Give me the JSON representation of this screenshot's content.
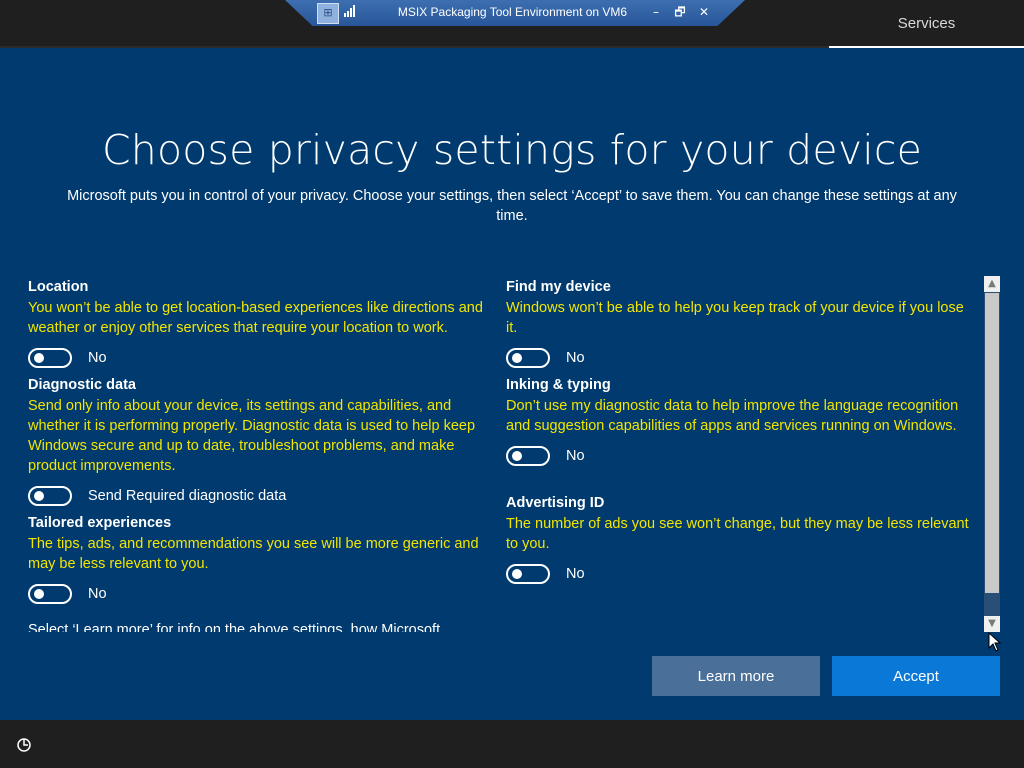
{
  "window": {
    "vm_title": "MSIX Packaging Tool Environment on VM6",
    "pin_icon": "pin-icon",
    "signal_icon": "signal-bars-icon",
    "controls": {
      "minimize": "–",
      "restore": "🗗",
      "close": "✕"
    }
  },
  "topbar": {
    "services_tab": "Services"
  },
  "page": {
    "title": "Choose privacy settings for your device",
    "subtitle": "Microsoft puts you in control of your privacy. Choose your settings, then select ‘Accept’ to save them. You can change these settings at any time."
  },
  "settings": {
    "left": [
      {
        "title": "Location",
        "description": "You won’t be able to get location-based experiences like directions and weather or enjoy other services that require your location to work.",
        "toggle": "No"
      },
      {
        "title": "Diagnostic data",
        "description": "Send only info about your device, its settings and capabilities, and whether it is performing properly. Diagnostic data is used to help keep Windows secure and up to date, troubleshoot problems, and make product improvements.",
        "toggle": "Send Required diagnostic data"
      },
      {
        "title": "Tailored experiences",
        "description": "The tips, ads, and recommendations you see will be more generic and may be less relevant to you.",
        "toggle": "No"
      }
    ],
    "right": [
      {
        "title": "Find my device",
        "description": "Windows won’t be able to help you keep track of your device if you lose it.",
        "toggle": "No"
      },
      {
        "title": "Inking & typing",
        "description": "Don’t use my diagnostic data to help improve the language recognition and suggestion capabilities of apps and services running on Windows.",
        "toggle": "No"
      },
      {
        "title": "Advertising ID",
        "description": "The number of ads you see won’t change, but they may be less relevant to you.",
        "toggle": "No"
      }
    ],
    "footer": "Select ‘Learn more’ for info on the above settings, how Microsoft"
  },
  "buttons": {
    "learn_more": "Learn more",
    "accept": "Accept"
  },
  "colors": {
    "background": "#003a6e",
    "description_text": "#f2e600",
    "accept_button": "#0a78d7",
    "learn_more_button": "#4a6f98",
    "chrome": "#1f1f1f"
  }
}
